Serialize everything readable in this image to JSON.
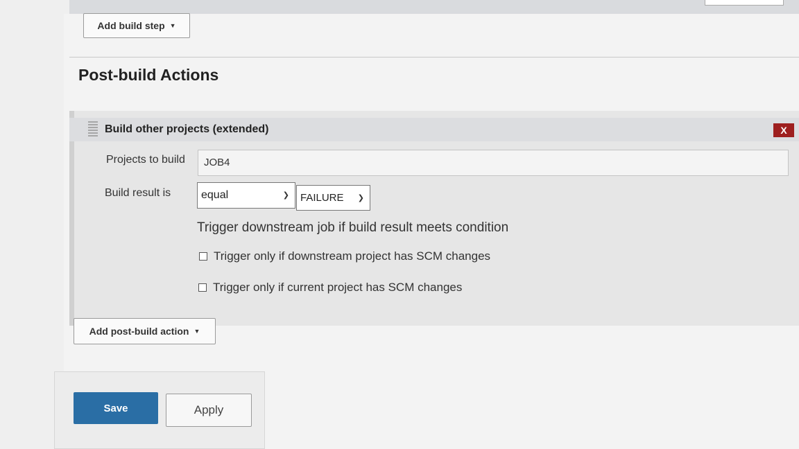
{
  "builders": {
    "add_build_step_label": "Add build step"
  },
  "post_build": {
    "section_title": "Post-build Actions",
    "action": {
      "title": "Build other projects (extended)",
      "delete_label": "X",
      "projects_label": "Projects to build",
      "projects_value": "JOB4",
      "result_label": "Build result is",
      "compare_value": "equal",
      "result_value": "FAILURE",
      "description": "Trigger downstream job if build result meets condition",
      "options": [
        {
          "label": "Trigger only if downstream project has SCM changes",
          "checked": false
        },
        {
          "label": "Trigger only if current project has SCM changes",
          "checked": false
        }
      ]
    },
    "add_action_label": "Add post-build action"
  },
  "footer": {
    "save_label": "Save",
    "apply_label": "Apply"
  },
  "colors": {
    "save_bg": "#2a6ea5",
    "delete_bg": "#9e1f1f"
  }
}
